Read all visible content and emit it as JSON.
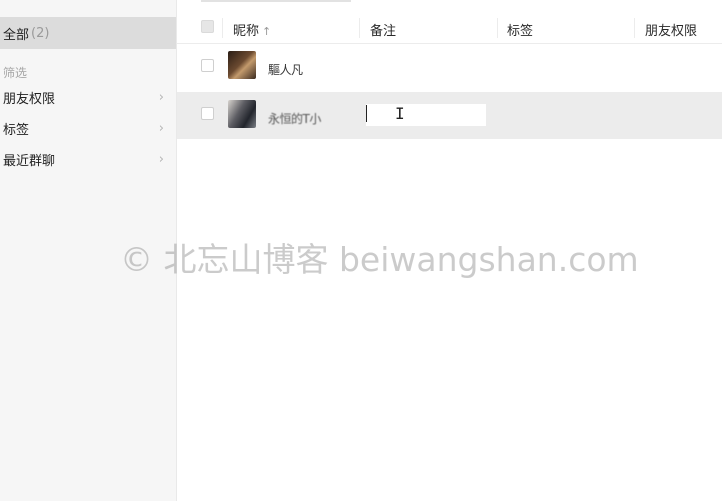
{
  "sidebar": {
    "all": {
      "label": "全部",
      "count": "(2)"
    },
    "filter_title": "筛选",
    "items": [
      {
        "label": "朋友权限",
        "chevron": "›"
      },
      {
        "label": "标签",
        "chevron": "›"
      },
      {
        "label": "最近群聊",
        "chevron": "›"
      }
    ]
  },
  "table": {
    "columns": [
      {
        "label": "昵称",
        "sort_indicator": "↑"
      },
      {
        "label": "备注"
      },
      {
        "label": "标签"
      },
      {
        "label": "朋友权限"
      }
    ],
    "rows": [
      {
        "nickname": "驅人凡",
        "remark": "",
        "tags": "",
        "permission": "",
        "selected": false
      },
      {
        "nickname": "永恒的T小",
        "remark": "",
        "tags": "",
        "permission": "",
        "selected": true
      }
    ]
  },
  "cursor": {
    "ibeam": "I"
  },
  "watermark": "© 北忘山博客 beiwangshan.com",
  "colors": {
    "sidebar_bg": "#f6f6f6",
    "sidebar_selected": "#dcdcdc",
    "row_selected": "#ececec",
    "watermark": "#8c8c8c"
  }
}
